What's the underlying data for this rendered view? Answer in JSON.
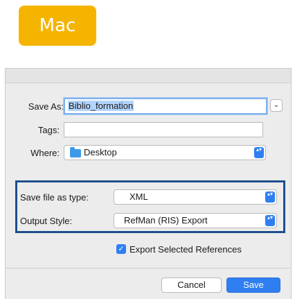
{
  "badge": {
    "label": "Mac",
    "color": "#f5b400"
  },
  "dialog": {
    "save_as": {
      "label": "Save As:",
      "value": "Biblio_formation"
    },
    "tags": {
      "label": "Tags:",
      "value": ""
    },
    "where": {
      "label": "Where:",
      "value": "Desktop",
      "icon": "folder-icon"
    },
    "save_file_type": {
      "label": "Save file as type:",
      "value": "XML"
    },
    "output_style": {
      "label": "Output Style:",
      "value": "RefMan (RIS) Export"
    },
    "export_selected": {
      "label": "Export Selected References",
      "checked": true
    },
    "buttons": {
      "cancel": "Cancel",
      "save": "Save"
    },
    "expand_glyph": "⌄",
    "popup_glyph": "▴▾",
    "check_glyph": "✓",
    "accent_color": "#2f7ff2",
    "highlight_color": "#1c4f8c"
  }
}
